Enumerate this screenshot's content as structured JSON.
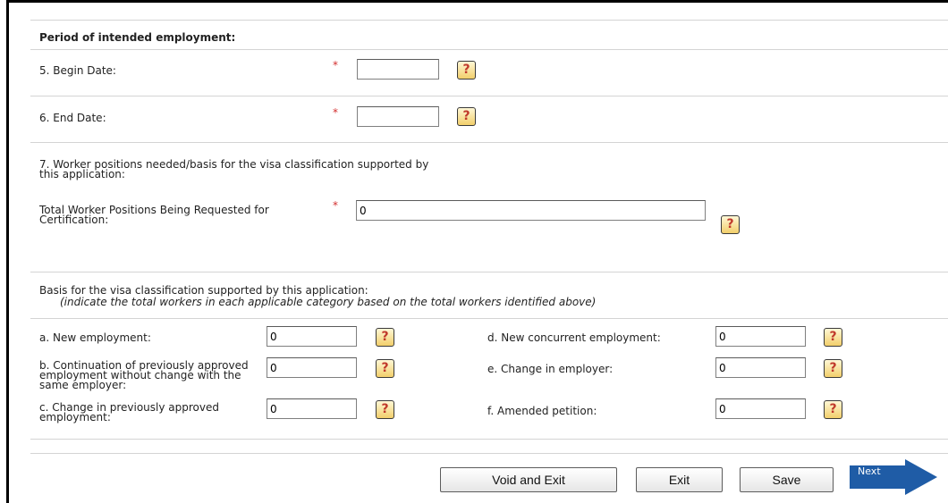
{
  "section_title": "Period of intended employment:",
  "begin_date": {
    "label": "5. Begin Date:",
    "value": ""
  },
  "end_date": {
    "label": "6. End Date:",
    "value": ""
  },
  "positions": {
    "intro": "7. Worker positions needed/basis for the visa classification supported by this application:",
    "total_label": "Total Worker Positions Being Requested for Certification:",
    "total_value": "0"
  },
  "basis": {
    "title": "Basis for the visa classification supported by this application:",
    "subtitle": "(indicate the total workers in each applicable category based on the total workers identified above)",
    "a": {
      "label": "a. New employment:",
      "value": "0"
    },
    "b": {
      "label": "b. Continuation of previously approved employment without change with the same employer:",
      "value": "0"
    },
    "c": {
      "label": "c. Change in previously approved employment:",
      "value": "0"
    },
    "d": {
      "label": "d. New concurrent employment:",
      "value": "0"
    },
    "e": {
      "label": "e. Change in employer:",
      "value": "0"
    },
    "f": {
      "label": "f. Amended petition:",
      "value": "0"
    }
  },
  "required_marker": "*",
  "help_glyph": "?",
  "help_icon": "question-help-icon",
  "buttons": {
    "void_exit": "Void and Exit",
    "exit": "Exit",
    "save": "Save",
    "next": "Next"
  },
  "colors": {
    "required": "#d32f2f",
    "next_arrow": "#1f5ca6",
    "help_icon_bg": "#f2cf6b"
  }
}
